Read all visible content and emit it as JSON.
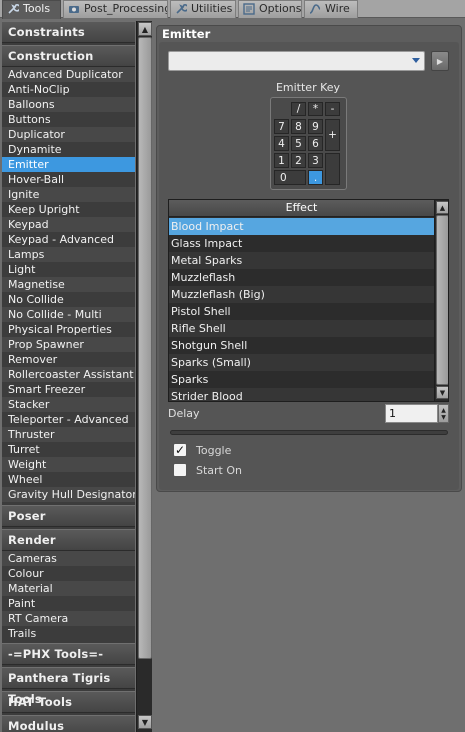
{
  "tabs": [
    {
      "label": "Tools",
      "icon": "wrench-icon",
      "active": true
    },
    {
      "label": "Post_Processing",
      "icon": "camera-icon",
      "active": false
    },
    {
      "label": "Utilities",
      "icon": "wrench-icon",
      "active": false
    },
    {
      "label": "Options",
      "icon": "options-icon",
      "active": false
    },
    {
      "label": "Wire",
      "icon": "wire-icon",
      "active": false
    }
  ],
  "categories": {
    "constraints": "Constraints",
    "construction": "Construction",
    "construction_items": [
      "Advanced Duplicator",
      "Anti-NoClip",
      "Balloons",
      "Buttons",
      "Duplicator",
      "Dynamite",
      "Emitter",
      "Hover-Ball",
      "Ignite",
      "Keep Upright",
      "Keypad",
      "Keypad - Advanced",
      "Lamps",
      "Light",
      "Magnetise",
      "No Collide",
      "No Collide - Multi",
      "Physical Properties",
      "Prop Spawner",
      "Remover",
      "Rollercoaster Assistant",
      "Smart Freezer",
      "Stacker",
      "Teleporter - Advanced",
      "Thruster",
      "Turret",
      "Weight",
      "Wheel",
      "Gravity Hull Designator"
    ],
    "selected_item": "Emitter",
    "poser": "Poser",
    "render": "Render",
    "render_items": [
      "Cameras",
      "Colour",
      "Material",
      "Paint",
      "RT Camera",
      "Trails"
    ],
    "phx": "-=PHX Tools=-",
    "panthera": "Panthera Tigris Tools",
    "hat": "HAT Tools",
    "modulus": "Modulus"
  },
  "panel": {
    "title": "Emitter",
    "combo_value": "",
    "keypad_label": "Emitter Key",
    "keys": {
      "slash": "/",
      "star": "*",
      "minus": "-",
      "k7": "7",
      "k8": "8",
      "k9": "9",
      "plus": "+",
      "k4": "4",
      "k5": "5",
      "k6": "6",
      "k1": "1",
      "k2": "2",
      "k3": "3",
      "k0": "0",
      "dot": ".",
      "enter": ""
    },
    "selected_key": ".",
    "effects_header": "Effect",
    "effects": [
      "Blood Impact",
      "Glass Impact",
      "Metal Sparks",
      "Muzzleflash",
      "Muzzleflash (Big)",
      "Pistol Shell",
      "Rifle Shell",
      "Shotgun Shell",
      "Sparks (Small)",
      "Sparks",
      "Strider Blood"
    ],
    "selected_effect": "Blood Impact",
    "delay_label": "Delay",
    "delay_value": "1",
    "toggle_label": "Toggle",
    "toggle_checked": true,
    "starton_label": "Start On",
    "starton_checked": false
  },
  "colors": {
    "accent": "#3d98e0",
    "panel": "#5d5d5d",
    "background": "#6f6f6f"
  }
}
